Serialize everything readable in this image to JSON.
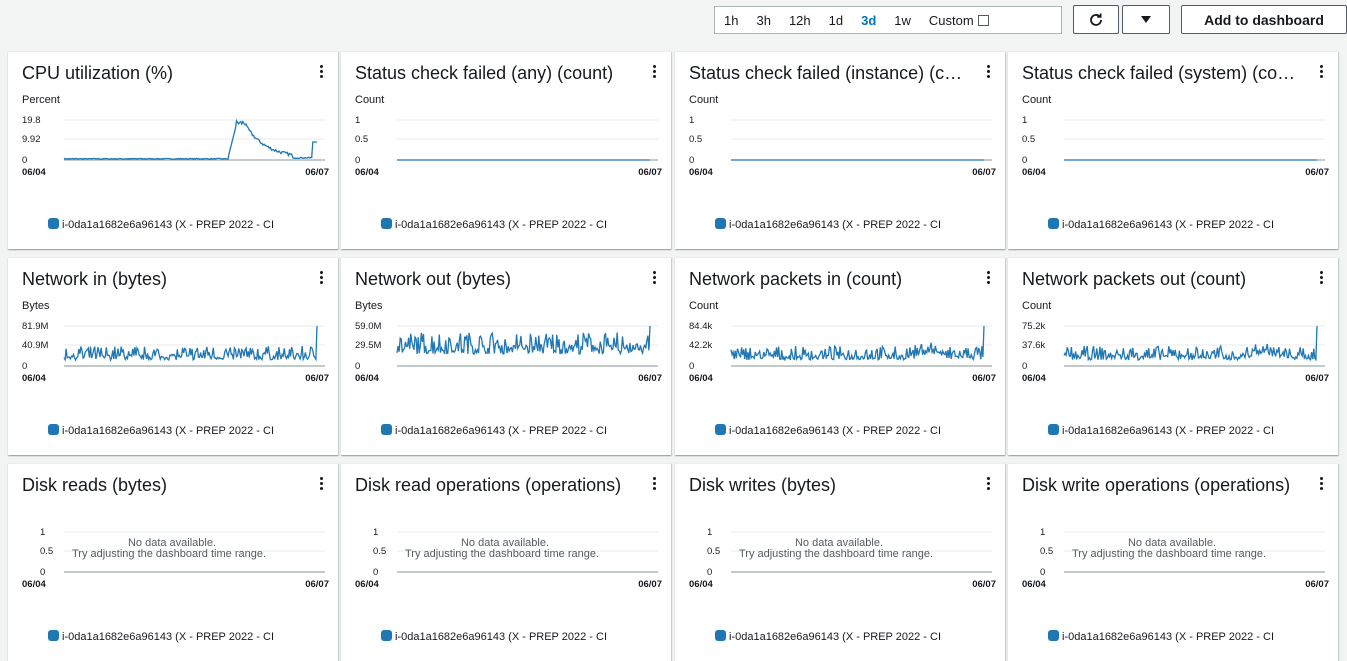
{
  "toolbar": {
    "ranges": [
      "1h",
      "3h",
      "12h",
      "1d",
      "3d",
      "1w"
    ],
    "active_range": "3d",
    "custom_label": "Custom",
    "add_label": "Add to dashboard"
  },
  "x_start_label": "06/04",
  "x_end_label": "06/07",
  "legend_label": "i-0da1a1682e6a96143 (X - PREP 2022 - CI",
  "series_color": "#1f77b4",
  "no_data": {
    "line1": "No data available.",
    "line2": "Try adjusting the dashboard time range."
  },
  "widgets": [
    {
      "title": "CPU utilization (%)",
      "unit": "Percent",
      "ticks": [
        "19.8",
        "9.92",
        "0"
      ],
      "data": true,
      "chart_data": {
        "type": "line",
        "x": [
          "06/04",
          "06/07"
        ],
        "ylabel": "Percent",
        "ylim": [
          0,
          19.8
        ],
        "series": [
          {
            "name": "i-0da1a1682e6a96143 (X - PREP 2022 - CI",
            "shape": "low near 0–1% until mid-range, spike to ~19.8% then decay, small rise at end"
          }
        ]
      }
    },
    {
      "title": "Status check failed (any) (count)",
      "unit": "Count",
      "ticks": [
        "1",
        "0.5",
        "0"
      ],
      "data": true,
      "chart_data": {
        "type": "line",
        "x": [
          "06/04",
          "06/07"
        ],
        "ylabel": "Count",
        "ylim": [
          0,
          1
        ],
        "series": [
          {
            "name": "i-0da1a1682e6a96143 (X - PREP 2022 - CI",
            "shape": "flat at 0"
          }
        ]
      }
    },
    {
      "title": "Status check failed (instance) (c…",
      "unit": "Count",
      "ticks": [
        "1",
        "0.5",
        "0"
      ],
      "data": true,
      "chart_data": {
        "type": "line",
        "x": [
          "06/04",
          "06/07"
        ],
        "ylabel": "Count",
        "ylim": [
          0,
          1
        ],
        "series": [
          {
            "name": "i-0da1a1682e6a96143 (X - PREP 2022 - CI",
            "shape": "flat at 0"
          }
        ]
      }
    },
    {
      "title": "Status check failed (system) (co…",
      "unit": "Count",
      "ticks": [
        "1",
        "0.5",
        "0"
      ],
      "data": true,
      "chart_data": {
        "type": "line",
        "x": [
          "06/04",
          "06/07"
        ],
        "ylabel": "Count",
        "ylim": [
          0,
          1
        ],
        "series": [
          {
            "name": "i-0da1a1682e6a96143 (X - PREP 2022 - CI",
            "shape": "flat at 0"
          }
        ]
      }
    },
    {
      "title": "Network in (bytes)",
      "unit": "Bytes",
      "ticks": [
        "81.9M",
        "40.9M",
        "0"
      ],
      "data": true,
      "chart_data": {
        "type": "line",
        "x": [
          "06/04",
          "06/07"
        ],
        "ylabel": "Bytes",
        "ylim": [
          0,
          81900000
        ],
        "series": [
          {
            "name": "i-0da1a1682e6a96143 (X - PREP 2022 - CI",
            "shape": "spiky around 10–40M, final spike near 81.9M"
          }
        ]
      }
    },
    {
      "title": "Network out (bytes)",
      "unit": "Bytes",
      "ticks": [
        "59.0M",
        "29.5M",
        "0"
      ],
      "data": true,
      "chart_data": {
        "type": "line",
        "x": [
          "06/04",
          "06/07"
        ],
        "ylabel": "Bytes",
        "ylim": [
          0,
          59000000
        ],
        "series": [
          {
            "name": "i-0da1a1682e6a96143 (X - PREP 2022 - CI",
            "shape": "dense spikes up to ~59M"
          }
        ]
      }
    },
    {
      "title": "Network packets in (count)",
      "unit": "Count",
      "ticks": [
        "84.4k",
        "42.2k",
        "0"
      ],
      "data": true,
      "chart_data": {
        "type": "line",
        "x": [
          "06/04",
          "06/07"
        ],
        "ylabel": "Count",
        "ylim": [
          0,
          84400
        ],
        "series": [
          {
            "name": "i-0da1a1682e6a96143 (X - PREP 2022 - CI",
            "shape": "noisy ~10–25k, final spike ~84.4k"
          }
        ]
      }
    },
    {
      "title": "Network packets out (count)",
      "unit": "Count",
      "ticks": [
        "75.2k",
        "37.6k",
        "0"
      ],
      "data": true,
      "chart_data": {
        "type": "line",
        "x": [
          "06/04",
          "06/07"
        ],
        "ylabel": "Count",
        "ylim": [
          0,
          75200
        ],
        "series": [
          {
            "name": "i-0da1a1682e6a96143 (X - PREP 2022 - CI",
            "shape": "noisy ~10–30k, final spike ~75.2k"
          }
        ]
      }
    },
    {
      "title": "Disk reads (bytes)",
      "unit": "",
      "ticks": [
        "1",
        "0.5",
        "0"
      ],
      "data": false
    },
    {
      "title": "Disk read operations (operations)",
      "unit": "",
      "ticks": [
        "1",
        "0.5",
        "0"
      ],
      "data": false
    },
    {
      "title": "Disk writes (bytes)",
      "unit": "",
      "ticks": [
        "1",
        "0.5",
        "0"
      ],
      "data": false
    },
    {
      "title": "Disk write operations (operations)",
      "unit": "",
      "ticks": [
        "1",
        "0.5",
        "0"
      ],
      "data": false
    }
  ]
}
